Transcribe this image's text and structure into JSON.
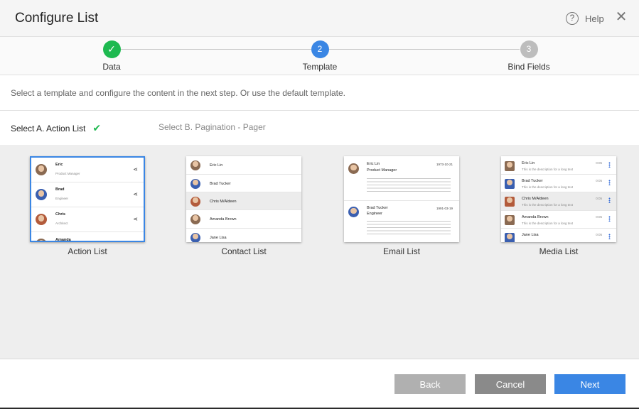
{
  "dialog": {
    "title": "Configure List",
    "help_label": "Help",
    "help_icon": "?",
    "close_icon": "✕"
  },
  "stepper": {
    "steps": [
      {
        "label": "Data",
        "marker": "✓",
        "state": "done",
        "color": "#1eb950"
      },
      {
        "label": "Template",
        "marker": "2",
        "state": "active",
        "color": "#3a86e4"
      },
      {
        "label": "Bind Fields",
        "marker": "3",
        "state": "pending",
        "color": "#bdbdbd"
      }
    ]
  },
  "intro": "Select a template and configure the content in the next step. Or use the default template.",
  "tabs": [
    {
      "label": "Select A. Action List",
      "check": "✔"
    },
    {
      "label": "Select B. Pagination - Pager"
    }
  ],
  "templates": {
    "action_list": {
      "label": "Action List",
      "rows": [
        {
          "name": "Eric",
          "sub": "Product Manager"
        },
        {
          "name": "Brad",
          "sub": "Engineer"
        },
        {
          "name": "Chris",
          "sub": "Architect"
        },
        {
          "name": "Amanda",
          "sub": ""
        }
      ],
      "share_icon": "⋖"
    },
    "contact_list": {
      "label": "Contact List",
      "rows": [
        "Eric Lin",
        "Brad Tucker",
        "Chris M/Aldeen",
        "Amanda Brown",
        "Jane Lisa"
      ]
    },
    "email_list": {
      "label": "Email List",
      "rows": [
        {
          "name": "Eric Lin",
          "sub": "Product Manager",
          "date": "1973-10-21"
        },
        {
          "name": "Brad Tucker",
          "sub": "Engineer",
          "date": "1991-03-19"
        }
      ]
    },
    "media_list": {
      "label": "Media List",
      "rows": [
        {
          "name": "Eric Lin",
          "desc": "This is the description for a long text",
          "time": "0:05"
        },
        {
          "name": "Brad Tucker",
          "desc": "This is the description for a long text",
          "time": "0:05"
        },
        {
          "name": "Chris M/Aldeen",
          "desc": "This is the description for a long text",
          "time": "0:05"
        },
        {
          "name": "Amanda Brown",
          "desc": "This is the description for a long text",
          "time": "0:05"
        },
        {
          "name": "Jane Lisa",
          "desc": "",
          "time": "0:05"
        }
      ]
    }
  },
  "footer": {
    "back": {
      "label": "Back",
      "color": "#b0b0b0"
    },
    "cancel": {
      "label": "Cancel",
      "color": "#8a8a8a"
    },
    "next": {
      "label": "Next",
      "color": "#3a86e4"
    }
  }
}
